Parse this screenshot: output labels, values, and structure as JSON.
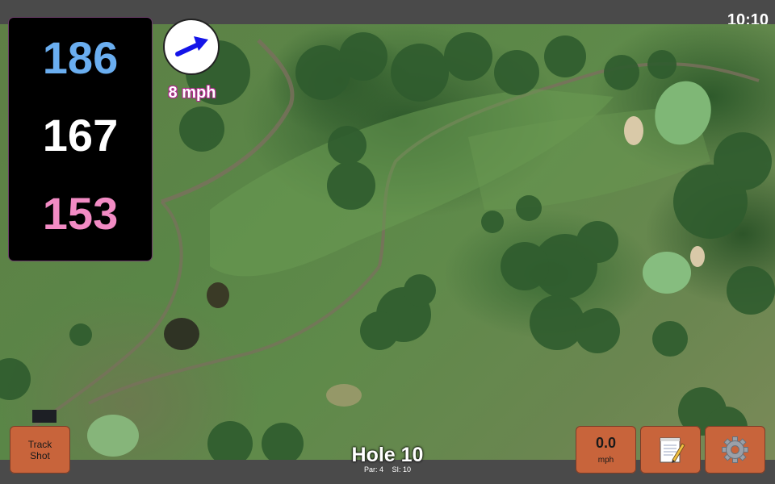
{
  "status_bar": {
    "time": "10:10"
  },
  "distances": {
    "back": "186",
    "middle": "167",
    "front": "153"
  },
  "wind": {
    "speed": "8 mph",
    "direction_icon": "wind-arrow-icon"
  },
  "hole": {
    "title": "Hole 10",
    "par": "Par: 4",
    "stroke_index": "SI: 10"
  },
  "buttons": {
    "track_shot": "Track\nShot",
    "speed_value": "0.0",
    "speed_unit": "mph",
    "notes_icon": "notepad-icon",
    "settings_icon": "gear-icon"
  },
  "colors": {
    "back_distance": "#6aaef0",
    "middle_distance": "#ffffff",
    "front_distance": "#f28bc4",
    "button_bg": "#c8643b",
    "wind_text_outline": "#b02a8e"
  }
}
